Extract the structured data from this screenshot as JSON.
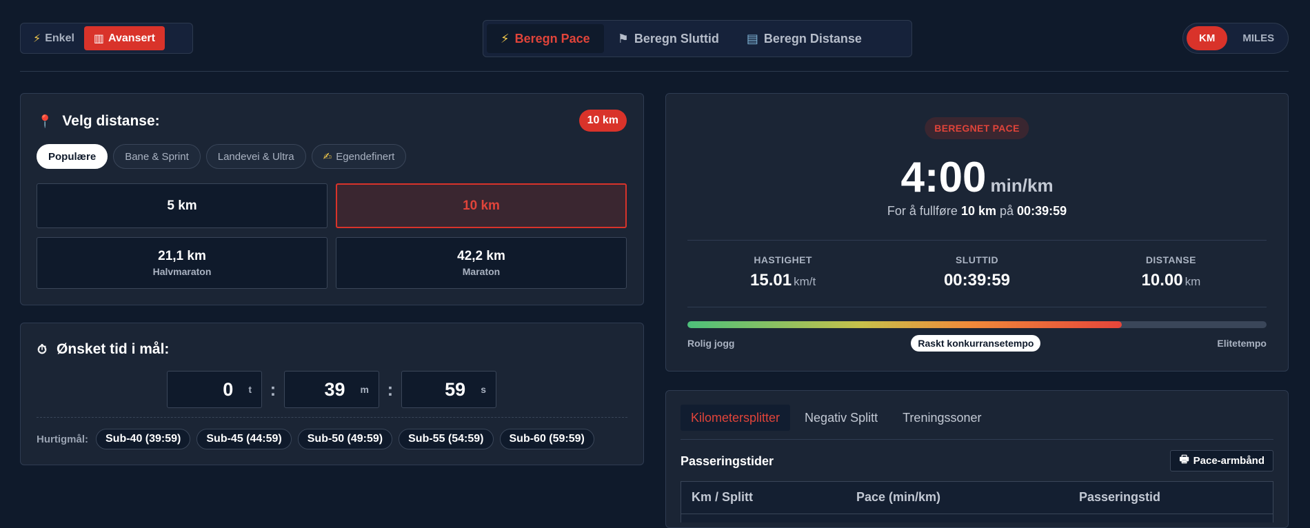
{
  "mode": {
    "simple": "Enkel",
    "advanced": "Avansert"
  },
  "calc_tabs": [
    "Beregn Pace",
    "Beregn Sluttid",
    "Beregn Distanse"
  ],
  "units": {
    "km": "KM",
    "miles": "MILES"
  },
  "distance": {
    "title": "Velg distanse:",
    "badge": "10 km",
    "chips": [
      "Populære",
      "Bane & Sprint",
      "Landevei & Ultra",
      "Egendefinert"
    ],
    "options": [
      {
        "label": "5 km",
        "sub": ""
      },
      {
        "label": "10 km",
        "sub": ""
      },
      {
        "label": "21,1 km",
        "sub": "Halvmaraton"
      },
      {
        "label": "42,2 km",
        "sub": "Maraton"
      }
    ]
  },
  "goal": {
    "title": "Ønsket tid i mål:",
    "hours": "0",
    "hours_unit": "t",
    "minutes": "39",
    "minutes_unit": "m",
    "seconds": "59",
    "seconds_unit": "s",
    "quick_label": "Hurtigmål:",
    "quick": [
      "Sub-40 (39:59)",
      "Sub-45 (44:59)",
      "Sub-50 (49:59)",
      "Sub-55 (54:59)",
      "Sub-60 (59:59)"
    ]
  },
  "result": {
    "badge": "BEREGNET PACE",
    "pace": "4:00",
    "pace_unit": "min/km",
    "desc_prefix": "For å fullføre",
    "desc_distance": "10 km",
    "desc_mid": "på",
    "desc_time": "00:39:59",
    "stats": [
      {
        "label": "HASTIGHET",
        "value": "15.01",
        "unit": "km/t"
      },
      {
        "label": "SLUTTID",
        "value": "00:39:59",
        "unit": ""
      },
      {
        "label": "DISTANSE",
        "value": "10.00",
        "unit": "km"
      }
    ],
    "intensity_fraction": 0.75,
    "bar_left": "Rolig jogg",
    "bar_mid": "Raskt konkurransetempo",
    "bar_right": "Elitetempo"
  },
  "splits": {
    "tabs": [
      "Kilometersplitter",
      "Negativ Splitt",
      "Treningssoner"
    ],
    "title": "Passeringstider",
    "armband": "Pace-armbånd",
    "columns": [
      "Km / Splitt",
      "Pace (min/km)",
      "Passeringstid"
    ]
  },
  "colors": {
    "accent": "#d9332a",
    "background": "#0f1a2b",
    "card": "#1b2535"
  }
}
